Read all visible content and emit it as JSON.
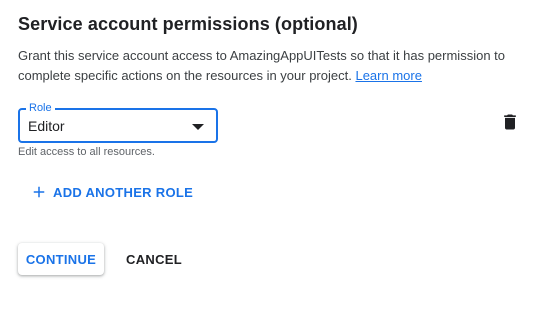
{
  "section": {
    "title": "Service account permissions (optional)",
    "description": "Grant this service account access to AmazingAppUITests so that it has permission to complete specific actions on the resources in your project.",
    "learn_more_label": "Learn more"
  },
  "role_field": {
    "label": "Role",
    "value": "Editor",
    "hint": "Edit access to all resources.",
    "dropdown_icon": "dropdown-arrow-icon",
    "delete_icon": "trash-icon"
  },
  "add_role": {
    "icon": "plus-icon",
    "label": "ADD ANOTHER ROLE"
  },
  "actions": {
    "continue_label": "CONTINUE",
    "cancel_label": "CANCEL"
  },
  "colors": {
    "accent": "#1a73e8",
    "text": "#202124",
    "secondary_text": "#5f6368"
  }
}
